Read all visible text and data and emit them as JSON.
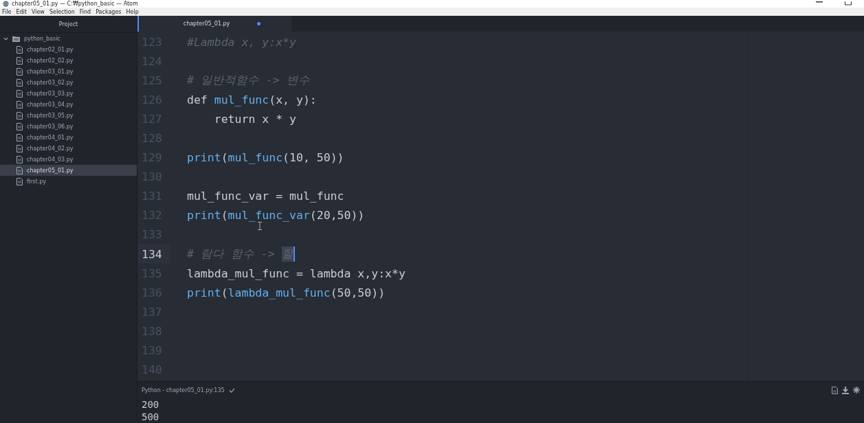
{
  "window": {
    "title": "chapter05_01.py — C:₩python_basic — Atom"
  },
  "menu": [
    "File",
    "Edit",
    "View",
    "Selection",
    "Find",
    "Packages",
    "Help"
  ],
  "sidebar": {
    "title": "Project",
    "folder": {
      "name": "python_basic",
      "expanded": true,
      "children": [
        {
          "name": "chapter02_01.py",
          "selected": false
        },
        {
          "name": "chapter02_02.py",
          "selected": false
        },
        {
          "name": "chapter03_01.py",
          "selected": false
        },
        {
          "name": "chapter03_02.py",
          "selected": false
        },
        {
          "name": "chapter03_03.py",
          "selected": false
        },
        {
          "name": "chapter03_04.py",
          "selected": false
        },
        {
          "name": "chapter03_05.py",
          "selected": false
        },
        {
          "name": "chapter03_06.py",
          "selected": false
        },
        {
          "name": "chapter04_01.py",
          "selected": false
        },
        {
          "name": "chapter04_02.py",
          "selected": false
        },
        {
          "name": "chapter04_03.py",
          "selected": false
        },
        {
          "name": "chapter05_01.py",
          "selected": true
        },
        {
          "name": "first.py",
          "selected": false
        }
      ]
    }
  },
  "tabs": [
    {
      "label": "chapter05_01.py",
      "selected": true,
      "modified": true
    }
  ],
  "editor": {
    "lines": [
      {
        "number": "123",
        "current": false,
        "tokens": [
          {
            "kind": "comment",
            "text": "#Lambda x, y:x*y"
          }
        ]
      },
      {
        "number": "124",
        "current": false
      },
      {
        "number": "125",
        "current": false,
        "tokens": [
          {
            "kind": "comment",
            "text": "# 일반적함수 -> 변수"
          }
        ]
      },
      {
        "number": "126",
        "current": false,
        "tokens": [
          {
            "kind": "plain",
            "text": "def "
          },
          {
            "kind": "func",
            "text": "mul_func"
          },
          {
            "kind": "plain",
            "text": "(x, y):"
          }
        ]
      },
      {
        "number": "127",
        "current": false,
        "tokens": [
          {
            "kind": "plain",
            "text": "    return x * y"
          }
        ]
      },
      {
        "number": "128",
        "current": false
      },
      {
        "number": "129",
        "current": false,
        "tokens": [
          {
            "kind": "func",
            "text": "print"
          },
          {
            "kind": "plain",
            "text": "("
          },
          {
            "kind": "func",
            "text": "mul_func"
          },
          {
            "kind": "plain",
            "text": "(10, 50))"
          }
        ]
      },
      {
        "number": "130",
        "current": false
      },
      {
        "number": "131",
        "current": false,
        "tokens": [
          {
            "kind": "plain",
            "text": "mul_func_var = mul_func"
          }
        ]
      },
      {
        "number": "132",
        "current": false,
        "tokens": [
          {
            "kind": "func",
            "text": "print"
          },
          {
            "kind": "plain",
            "text": "("
          },
          {
            "kind": "func",
            "text": "mul_func_var"
          },
          {
            "kind": "plain",
            "text": "(20,50))"
          }
        ]
      },
      {
        "number": "133",
        "current": false
      },
      {
        "number": "134",
        "current": true,
        "tokens": [
          {
            "kind": "comment",
            "text": "# 람다 함수 -> "
          },
          {
            "kind": "selection",
            "text": "할"
          }
        ]
      },
      {
        "number": "135",
        "current": false,
        "tokens": [
          {
            "kind": "plain",
            "text": "lambda_mul_func = lambda x,y:x*y"
          }
        ]
      },
      {
        "number": "136",
        "current": false,
        "tokens": [
          {
            "kind": "func",
            "text": "print"
          },
          {
            "kind": "plain",
            "text": "("
          },
          {
            "kind": "func",
            "text": "lambda_mul_func"
          },
          {
            "kind": "plain",
            "text": "(50,50))"
          }
        ]
      },
      {
        "number": "137",
        "current": false
      },
      {
        "number": "138",
        "current": false
      },
      {
        "number": "139",
        "current": false
      },
      {
        "number": "140",
        "current": false
      }
    ]
  },
  "status_bar": {
    "text": "Python - chapter05_01.py:135"
  },
  "output": {
    "lines": [
      "200",
      "500"
    ]
  }
}
